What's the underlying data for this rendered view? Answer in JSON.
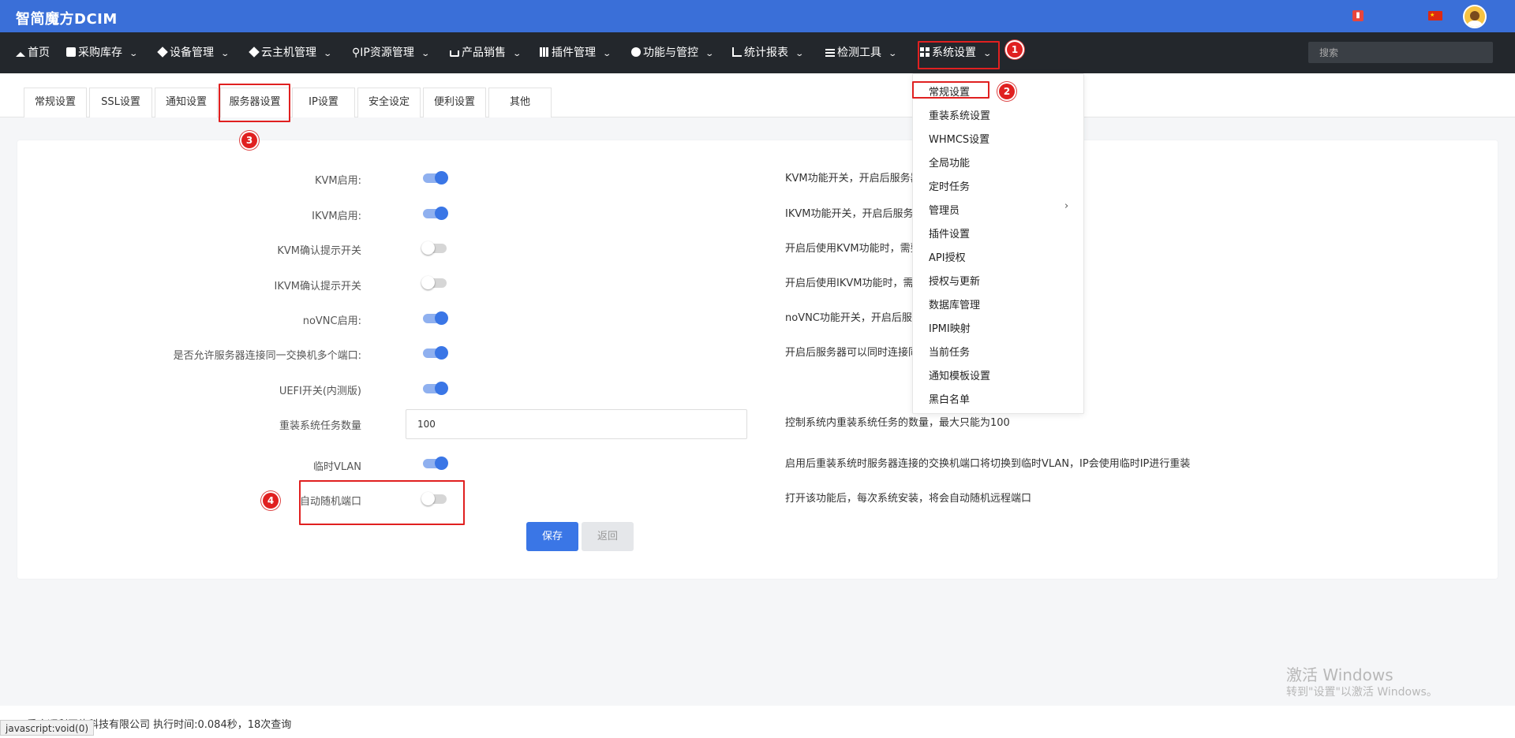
{
  "header": {
    "brand": "智简魔方DCIM",
    "gift_icon": "gift-icon",
    "flag_icon": "china-flag-icon",
    "avatar_icon": "avatar-icon"
  },
  "nav": {
    "items": [
      {
        "label": "首页",
        "icon": "home-icon"
      },
      {
        "label": "采购库存",
        "icon": "box-icon"
      },
      {
        "label": "设备管理",
        "icon": "cube-icon"
      },
      {
        "label": "云主机管理",
        "icon": "cube-icon"
      },
      {
        "label": "IP资源管理",
        "icon": "map-pin-icon"
      },
      {
        "label": "产品销售",
        "icon": "cart-icon"
      },
      {
        "label": "插件管理",
        "icon": "grid-icon"
      },
      {
        "label": "功能与管控",
        "icon": "info-icon"
      },
      {
        "label": "统计报表",
        "icon": "line-chart-icon"
      },
      {
        "label": "检测工具",
        "icon": "list-icon"
      },
      {
        "label": "系统设置",
        "icon": "windows-icon"
      }
    ],
    "search_placeholder": "搜索"
  },
  "markers": [
    "1",
    "2",
    "3",
    "4"
  ],
  "tabs": [
    "常规设置",
    "SSL设置",
    "通知设置",
    "服务器设置",
    "IP设置",
    "安全设定",
    "便利设置",
    "其他"
  ],
  "dropdown": {
    "items": [
      "常规设置",
      "重装系统设置",
      "WHMCS设置",
      "全局功能",
      "定时任务",
      "管理员",
      "插件设置",
      "API授权",
      "授权与更新",
      "数据库管理",
      "IPMI映射",
      "当前任务",
      "通知模板设置",
      "黑白名单"
    ],
    "submenu_arrow": "›"
  },
  "form": {
    "rows": [
      {
        "label": "KVM启用:",
        "toggle": true,
        "desc": "KVM功能开关，开启后服务器"
      },
      {
        "label": "IKVM启用:",
        "toggle": true,
        "desc": "IKVM功能开关，开启后服务器"
      },
      {
        "label": "KVM确认提示开关",
        "toggle": false,
        "desc": "开启后使用KVM功能时，需要"
      },
      {
        "label": "IKVM确认提示开关",
        "toggle": false,
        "desc": "开启后使用IKVM功能时，需要"
      },
      {
        "label": "noVNC启用:",
        "toggle": true,
        "desc": "noVNC功能开关，开启后服务"
      },
      {
        "label": "是否允许服务器连接同一交换机多个端口:",
        "toggle": true,
        "desc": "开启后服务器可以同时连接同"
      },
      {
        "label": "UEFI开关(内测版)",
        "toggle": true,
        "desc": ""
      },
      {
        "label": "重装系统任务数量",
        "value": "100",
        "desc": "控制系统内重装系统任务的数量，最大只能为100"
      },
      {
        "label": "临时VLAN",
        "toggle": true,
        "desc": "启用后重装系统时服务器连接的交换机端口将切换到临时VLAN，IP会使用临时IP进行重装"
      },
      {
        "label": "自动随机端口",
        "toggle": false,
        "desc": "打开该功能后，每次系统安装，将会自动随机远程端口"
      }
    ],
    "save_label": "保存",
    "back_label": "返回"
  },
  "footer": {
    "text": "重庆顺利网络科技有限公司    执行时间:0.084秒，18次查询",
    "status_url": "javascript:void(0)"
  },
  "watermark": {
    "line1": "激活 Windows",
    "line2": "转到\"设置\"以激活 Windows。"
  },
  "colors": {
    "brand_bar": "#3a6fd8",
    "nav_bar": "#23272c",
    "accent": "#3a76e6",
    "annotation_red": "#e02020"
  }
}
